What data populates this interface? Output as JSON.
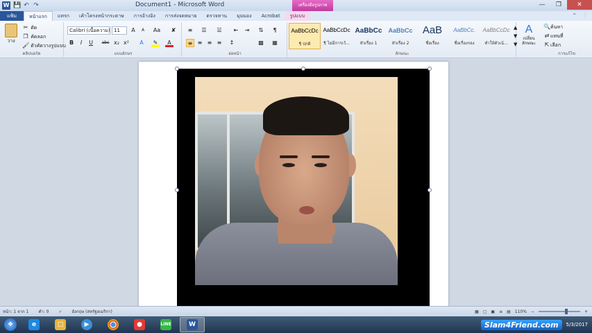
{
  "window": {
    "title": "Document1 - Microsoft Word",
    "context_tab_top": "เครื่องมือรูปภาพ"
  },
  "qat": {
    "app_icon": "W",
    "save_icon": "save-icon",
    "undo_icon": "undo-icon",
    "redo_icon": "redo-icon"
  },
  "tabs": {
    "file": "แฟ้ม",
    "items": [
      "หน้าแรก",
      "แทรก",
      "เค้าโครงหน้ากระดาษ",
      "การอ้างอิง",
      "การส่งจดหมาย",
      "ตรวจทาน",
      "มุมมอง",
      "Acrobat",
      "รูปแบบ"
    ]
  },
  "ribbon": {
    "clipboard": {
      "paste": "วาง",
      "cut": "ตัด",
      "copy": "คัดลอก",
      "format_painter": "ตัวคัดวางรูปแบบ",
      "label": "คลิปบอร์ด"
    },
    "font": {
      "font_name": "Calibri (เนื้อความ)",
      "font_size": "11",
      "grow": "A",
      "shrink": "A",
      "case": "Aa",
      "bold": "B",
      "italic": "I",
      "underline": "U",
      "strike": "abc",
      "subscript": "x₂",
      "superscript": "x²",
      "label": "แบบอักษร"
    },
    "paragraph": {
      "label": "ย่อหน้า",
      "pilcrow": "¶"
    },
    "styles": {
      "label": "ลักษณะ",
      "items": [
        {
          "preview": "AaBbCcDc",
          "name": "¶ ปกติ"
        },
        {
          "preview": "AaBbCcDc",
          "name": "¶ ไม่มีการเว้..."
        },
        {
          "preview": "AaBbCc",
          "name": "หัวเรื่อง 1"
        },
        {
          "preview": "AaBbCc",
          "name": "หัวเรื่อง 2"
        },
        {
          "preview": "AaB",
          "name": "ชื่อเรื่อง"
        },
        {
          "preview": "AaBbCc.",
          "name": "ชื่อเรื่องรอง"
        },
        {
          "preview": "AaBbCcDc",
          "name": "ทำให้ตัวเน้..."
        }
      ],
      "change_styles": "เปลี่ยนลักษณะ"
    },
    "editing": {
      "find": "ค้นหา",
      "replace": "แทนที่",
      "select": "เลือก",
      "label": "การแก้ไข"
    }
  },
  "status": {
    "page": "หน้า: 1 จาก 1",
    "words": "คำ: 0",
    "language": "อังกฤษ (สหรัฐอเมริกา)",
    "zoom": "110%"
  },
  "taskbar": {
    "items": [
      "windows-start",
      "ie-icon",
      "explorer-icon",
      "media-icon",
      "chrome-icon",
      "app-icon",
      "line-icon",
      "word-icon"
    ],
    "watermark": "Slam4Friend.com",
    "date": "5/3/2017"
  }
}
